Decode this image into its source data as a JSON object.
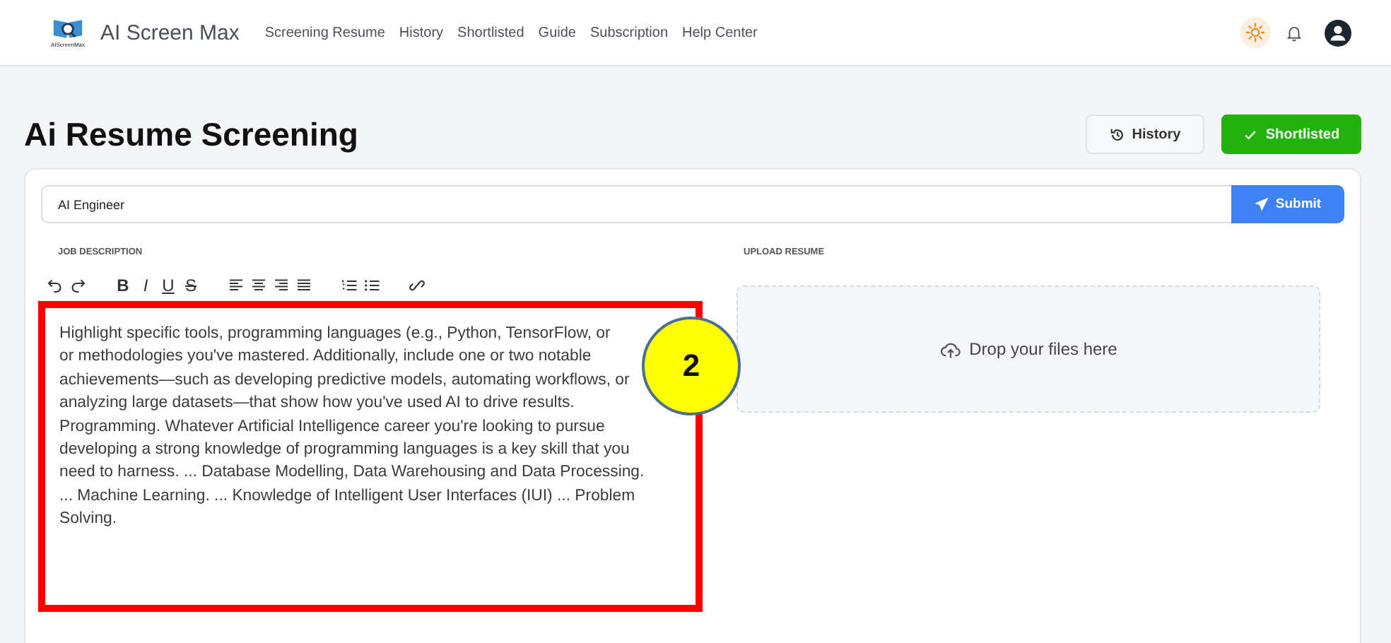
{
  "app": {
    "brand": "AI Screen Max",
    "logo_caption": "AIScreenMax",
    "nav": [
      "Screening Resume",
      "History",
      "Shortlisted",
      "Guide",
      "Subscription",
      "Help Center"
    ]
  },
  "page": {
    "title": "Ai Resume Screening",
    "buttons": [
      {
        "label": "History",
        "kind": "outline"
      },
      {
        "label": "Shortlisted",
        "kind": "primary"
      }
    ]
  },
  "form": {
    "job_title": "AI Engineer",
    "submit": "Submit",
    "job_description_label": "JOB DESCRIPTION",
    "format_letters": [
      "B",
      "I",
      "U",
      "S"
    ],
    "job_description_lines": [
      "Highlight specific tools, programming languages (e.g., Python, TensorFlow, or",
      "or methodologies you've mastered. Additionally, include one or two notable",
      "achievements—such as developing predictive models, automating workflows, or",
      "analyzing large datasets—that show how you've used AI to drive results.",
      "Programming. Whatever Artificial Intelligence career you're looking to pursue",
      "developing a strong knowledge of programming languages is a key skill that you",
      "need to harness. ... Database Modelling, Data Warehousing and Data Processing.",
      "... Machine Learning. ... Knowledge of Intelligent User Interfaces (IUI) ... Problem",
      "Solving."
    ],
    "upload_label": "UPLOAD RESUME",
    "dropzone_text": "Drop your files here"
  },
  "annotation": {
    "number": "2"
  }
}
